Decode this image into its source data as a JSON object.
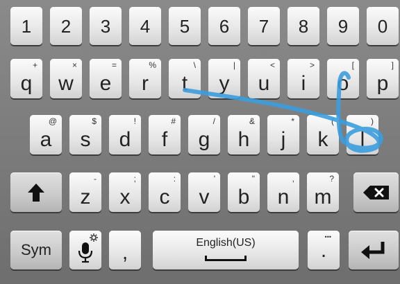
{
  "keyboard": {
    "number_row": [
      "1",
      "2",
      "3",
      "4",
      "5",
      "6",
      "7",
      "8",
      "9",
      "0"
    ],
    "row1": [
      {
        "main": "q",
        "sub": "+"
      },
      {
        "main": "w",
        "sub": "×"
      },
      {
        "main": "e",
        "sub": "="
      },
      {
        "main": "r",
        "sub": "%"
      },
      {
        "main": "t",
        "sub": "\\"
      },
      {
        "main": "y",
        "sub": "|"
      },
      {
        "main": "u",
        "sub": "<"
      },
      {
        "main": "i",
        "sub": ">"
      },
      {
        "main": "o",
        "sub": "["
      },
      {
        "main": "p",
        "sub": "]"
      }
    ],
    "row2": [
      {
        "main": "a",
        "sub": "@"
      },
      {
        "main": "s",
        "sub": "$"
      },
      {
        "main": "d",
        "sub": "!"
      },
      {
        "main": "f",
        "sub": "#"
      },
      {
        "main": "g",
        "sub": "/"
      },
      {
        "main": "h",
        "sub": "&"
      },
      {
        "main": "j",
        "sub": "*"
      },
      {
        "main": "k",
        "sub": "("
      },
      {
        "main": "l",
        "sub": ")"
      }
    ],
    "row3": [
      {
        "main": "z",
        "sub": "-"
      },
      {
        "main": "x",
        "sub": ";"
      },
      {
        "main": "c",
        "sub": ":"
      },
      {
        "main": "v",
        "sub": "'"
      },
      {
        "main": "b",
        "sub": "\""
      },
      {
        "main": "n",
        "sub": ","
      },
      {
        "main": "m",
        "sub": "?"
      }
    ],
    "sym_label": "Sym",
    "comma": ",",
    "space_label": "English(US)",
    "period": ".",
    "period_sub": "•••",
    "icons": {
      "shift": "shift-arrow-icon",
      "backspace": "backspace-icon",
      "mic": "microphone-icon",
      "gear": "gear-icon",
      "enter": "enter-icon"
    },
    "colors": {
      "background": "#7c7c7c",
      "key": "#e8e8e8",
      "swipe_trail": "#3b9ddd"
    }
  }
}
